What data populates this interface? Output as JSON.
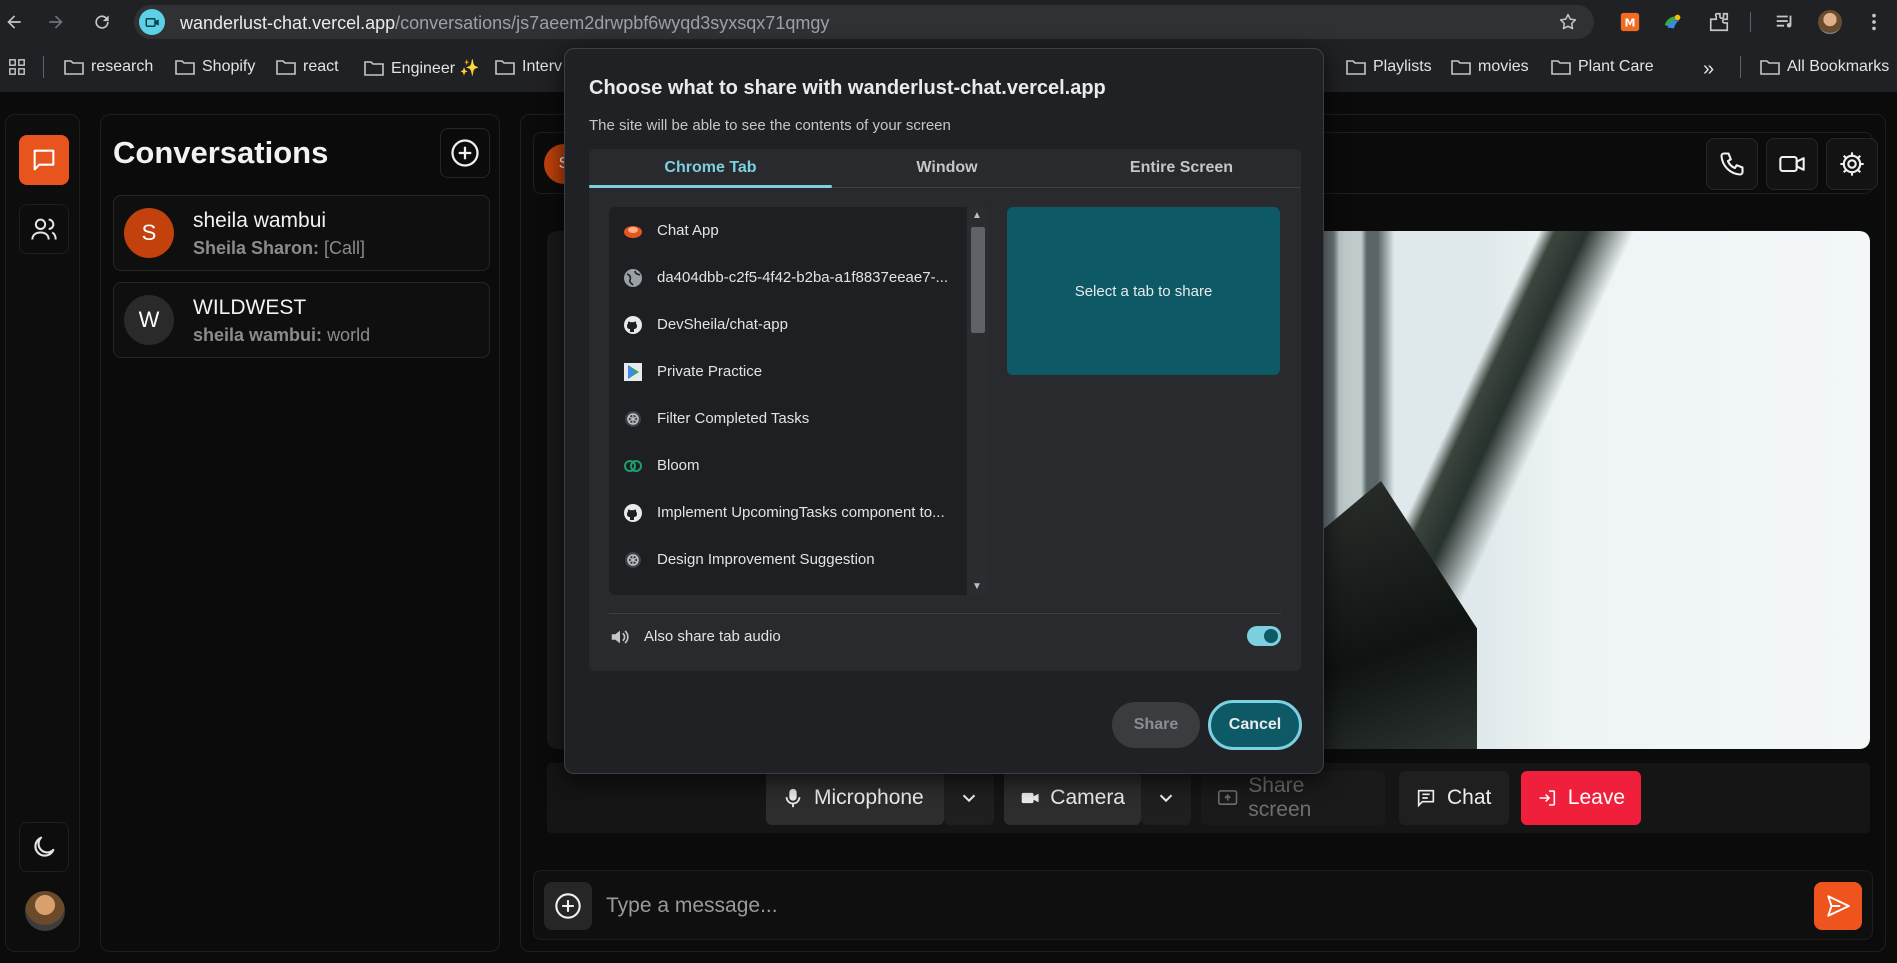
{
  "browser": {
    "url_host": "wanderlust-chat.vercel.app",
    "url_path": "/conversations/js7aeem2drwpbf6wyqd3syxsqx71qmgy",
    "bookmarks": [
      "research",
      "Shopify",
      "react",
      "Engineer ✨",
      "Interv",
      "Playlists",
      "movies",
      "Plant Care"
    ],
    "all_bookmarks_label": "All Bookmarks",
    "more_label": "»"
  },
  "sidebar": {
    "title": "Conversations",
    "conversations": [
      {
        "initial": "S",
        "name": "sheila wambui",
        "sender": "Sheila Sharon:",
        "message": "[Call]",
        "color": "#c2410c"
      },
      {
        "initial": "W",
        "name": "WILDWEST",
        "sender": "sheila wambui:",
        "message": "world",
        "color": "#2a2a2a"
      }
    ]
  },
  "header": {
    "avatar_initial": "S"
  },
  "controls": {
    "microphone": "Microphone",
    "camera": "Camera",
    "share_screen": "Share screen",
    "chat": "Chat",
    "leave": "Leave"
  },
  "composer": {
    "placeholder": "Type a message..."
  },
  "dialog": {
    "title": "Choose what to share with wanderlust-chat.vercel.app",
    "subtitle": "The site will be able to see the contents of your screen",
    "tabs": [
      "Chrome Tab",
      "Window",
      "Entire Screen"
    ],
    "active_tab": "Chrome Tab",
    "tab_items": [
      {
        "label": "Chat App",
        "icon": "chat-app-icon"
      },
      {
        "label": "da404dbb-c2f5-4f42-b2ba-a1f8837eeae7-...",
        "icon": "globe-icon"
      },
      {
        "label": "DevSheila/chat-app",
        "icon": "github-icon"
      },
      {
        "label": "Private Practice",
        "icon": "play-store-icon"
      },
      {
        "label": "Filter Completed Tasks",
        "icon": "openai-icon"
      },
      {
        "label": "Bloom",
        "icon": "bloom-icon"
      },
      {
        "label": "Implement UpcomingTasks component to...",
        "icon": "github-icon"
      },
      {
        "label": "Design Improvement Suggestion",
        "icon": "openai-icon"
      }
    ],
    "preview_text": "Select a tab to share",
    "audio_label": "Also share tab audio",
    "audio_enabled": true,
    "share_label": "Share",
    "cancel_label": "Cancel"
  },
  "colors": {
    "accent": "#e8541e",
    "dialog_accent": "#7cd0e0",
    "preview_bg": "#0d5966",
    "leave": "#f0203c"
  }
}
